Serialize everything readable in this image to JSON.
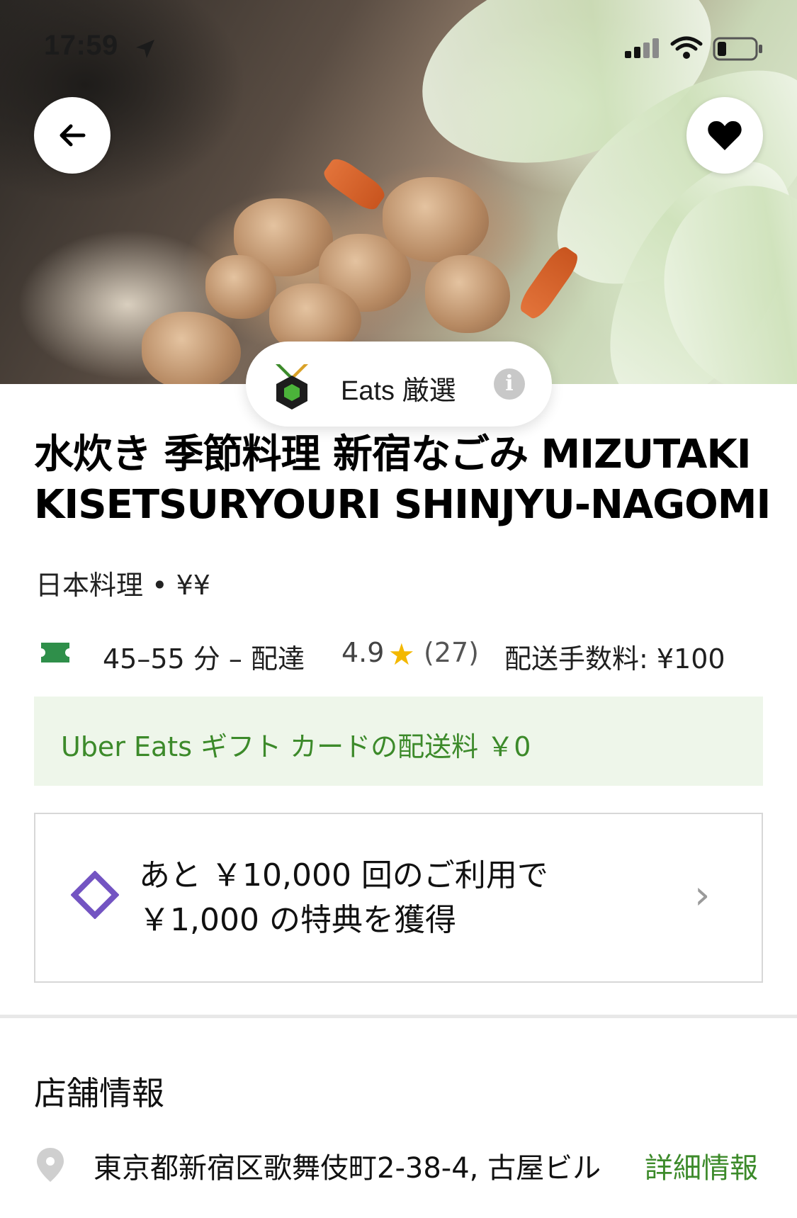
{
  "status_bar": {
    "time": "17:59"
  },
  "hero": {
    "image": "mizutaki hot pot with chicken and napa cabbage"
  },
  "badge": {
    "label": "Eats 厳選",
    "info_icon": "i"
  },
  "restaurant": {
    "name": "水炊き 季節料理 新宿なごみ MIZUTAKI KISETSURYOURI SHINJYU-NAGOMI",
    "category": "日本料理 • ¥¥",
    "eta": "45–55 分 – 配達",
    "rating": "4.9",
    "review_count": "(27)",
    "delivery_fee": "配送手数料: ¥100"
  },
  "gift_banner": {
    "text": "Uber Eats ギフト カードの配送料 ￥0"
  },
  "reward": {
    "line1": "あと ￥10,000 回のご利用で",
    "line2": "￥1,000 の特典を獲得"
  },
  "store_info": {
    "heading": "店舗情報",
    "address": "東京都新宿区歌舞伎町2-38-4, 古屋ビル",
    "more_label": "詳細情報"
  },
  "colors": {
    "accent_green": "#3c8a2a",
    "banner_bg": "#eef6ea",
    "star": "#f3b800",
    "diamond": "#7354c2"
  }
}
